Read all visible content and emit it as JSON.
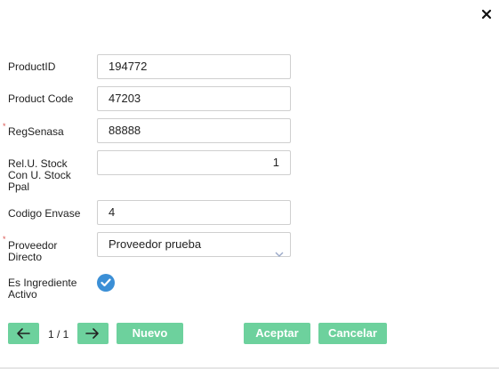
{
  "form": {
    "productid_label": "ProductID",
    "productid_value": "194772",
    "productcode_label": "Product Code",
    "productcode_value": "47203",
    "regsenasa_label": "RegSenasa",
    "regsenasa_value": "88888",
    "relu_label_lines": [
      "Rel.U. Stock",
      "Con U. Stock",
      "Ppal"
    ],
    "relu_value": "1",
    "envase_label": "Codigo Envase",
    "envase_value": "4",
    "proveedor_label_lines": [
      "Proveedor",
      "Directo"
    ],
    "proveedor_value": "Proveedor prueba",
    "ingrediente_label_lines": [
      "Es Ingrediente",
      "Activo"
    ],
    "ingrediente_checked": true,
    "required_marker": "*"
  },
  "footer": {
    "pager_text": "1 / 1",
    "nuevo_label": "Nuevo",
    "aceptar_label": "Aceptar",
    "cancelar_label": "Cancelar"
  },
  "icons": {
    "close": "close-icon",
    "prev": "arrow-left-icon",
    "next": "arrow-right-icon",
    "dropdown": "chevron-down-icon",
    "check": "checkmark-icon"
  },
  "colors": {
    "button": "#6dd19d",
    "check": "#3b8fd6",
    "required": "#d9534f"
  }
}
